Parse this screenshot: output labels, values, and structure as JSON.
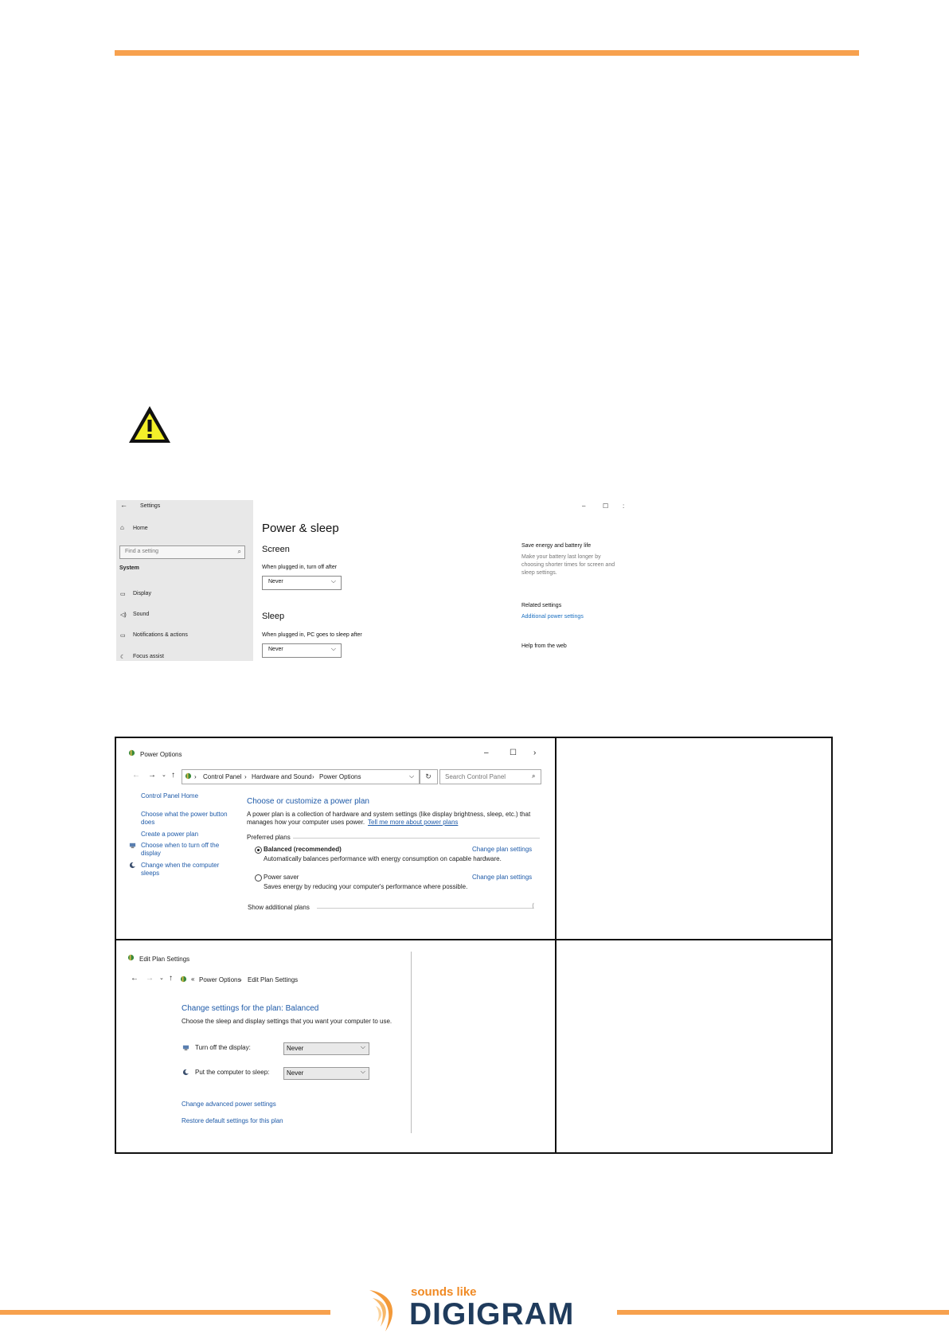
{
  "settings": {
    "title": "Settings",
    "home": "Home",
    "find_placeholder": "Find a setting",
    "section": "System",
    "nav": [
      "Display",
      "Sound",
      "Notifications & actions",
      "Focus assist"
    ],
    "heading": "Power & sleep",
    "screen_heading": "Screen",
    "screen_label": "When plugged in, turn off after",
    "screen_value": "Never",
    "sleep_heading": "Sleep",
    "sleep_label": "When plugged in, PC goes to sleep after",
    "sleep_value": "Never",
    "tip_title": "Save energy and battery life",
    "tip_text": [
      "Make your battery last longer by",
      "choosing shorter times for screen and",
      "sleep settings."
    ],
    "related_title": "Related settings",
    "related_link": "Additional power settings",
    "help_title": "Help from the web"
  },
  "power_options": {
    "window_title": "Power Options",
    "breadcrumb": [
      "Control Panel",
      "Hardware and Sound",
      "Power Options"
    ],
    "search_placeholder": "Search Control Panel",
    "side_links": [
      "Control Panel Home",
      "Choose what the power button",
      "does",
      "Create a power plan",
      "Choose when to turn off the",
      "display",
      "Change when the computer",
      "sleeps"
    ],
    "heading": "Choose or customize a power plan",
    "intro1": "A power plan is a collection of hardware and system settings (like display brightness, sleep, etc.) that",
    "intro2": "manages how your computer uses power.",
    "intro_link": "Tell me more about power plans",
    "preferred": "Preferred plans",
    "plan1_name": "Balanced (recommended)",
    "plan1_desc": "Automatically balances performance with energy consumption on capable hardware.",
    "plan2_name": "Power saver",
    "plan2_desc": "Saves energy by reducing your computer's performance where possible.",
    "change_link": "Change plan settings",
    "show_more": "Show additional plans"
  },
  "edit_plan": {
    "window_title": "Edit Plan Settings",
    "breadcrumb": [
      "Power Options",
      "Edit Plan Settings"
    ],
    "heading": "Change settings for the plan: Balanced",
    "subtitle": "Choose the sleep and display settings that you want your computer to use.",
    "display_label": "Turn off the display:",
    "display_value": "Never",
    "sleep_label": "Put the computer to sleep:",
    "sleep_value": "Never",
    "advanced_link": "Change advanced power settings",
    "restore_link": "Restore default settings for this plan"
  },
  "footer": {
    "tagline": "sounds like",
    "brand": "DIGIGRAM"
  }
}
